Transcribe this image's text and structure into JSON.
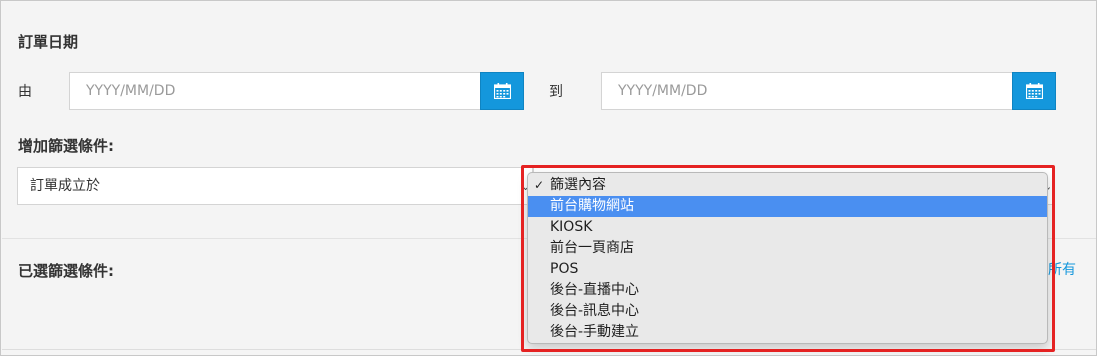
{
  "order_date": {
    "title": "訂單日期",
    "from_label": "由",
    "to_label": "到",
    "from_placeholder": "YYYY/MM/DD",
    "to_placeholder": "YYYY/MM/DD",
    "calendar_icon": "calendar-icon"
  },
  "add_filter": {
    "title": "增加篩選條件:",
    "field_value": "訂單成立於",
    "dropdown": {
      "options": [
        {
          "label": "篩選內容",
          "checked": true
        },
        {
          "label": "前台購物網站",
          "highlighted": true
        },
        {
          "label": "KIOSK"
        },
        {
          "label": "前台一頁商店"
        },
        {
          "label": "POS"
        },
        {
          "label": "後台-直播中心"
        },
        {
          "label": "後台-訊息中心"
        },
        {
          "label": "後台-手動建立"
        }
      ]
    }
  },
  "selected_filters": {
    "title": "已選篩選條件:",
    "clear_all_partial": "所有"
  },
  "colors": {
    "accent": "#1497dc",
    "selection": "#4a8ff1",
    "highlight_border": "#e52222"
  }
}
